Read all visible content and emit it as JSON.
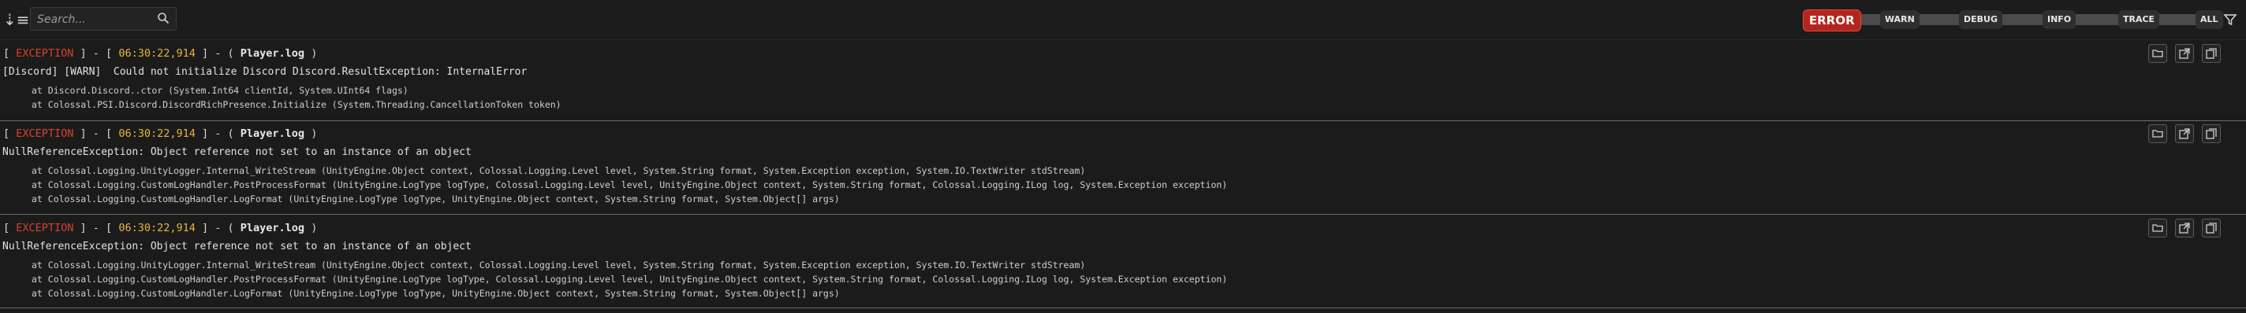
{
  "toolbar": {
    "search": {
      "placeholder": "Search..."
    },
    "levels": [
      {
        "label": "ERROR",
        "active": true
      },
      {
        "label": "WARN",
        "active": false
      },
      {
        "label": "DEBUG",
        "active": false
      },
      {
        "label": "INFO",
        "active": false
      },
      {
        "label": "TRACE",
        "active": false
      },
      {
        "label": "ALL",
        "active": false
      }
    ]
  },
  "entries": [
    {
      "level": "EXCEPTION",
      "time": "06:30:22,914",
      "file": "Player.log",
      "message": "[Discord] [WARN]  Could not initialize Discord Discord.ResultException: InternalError",
      "stack": [
        "at Discord.Discord..ctor (System.Int64 clientId, System.UInt64 flags)",
        "at Colossal.PSI.Discord.DiscordRichPresence.Initialize (System.Threading.CancellationToken token)"
      ]
    },
    {
      "level": "EXCEPTION",
      "time": "06:30:22,914",
      "file": "Player.log",
      "message": "NullReferenceException: Object reference not set to an instance of an object",
      "stack": [
        "at Colossal.Logging.UnityLogger.Internal_WriteStream (UnityEngine.Object context, Colossal.Logging.Level level, System.String format, System.Exception exception, System.IO.TextWriter stdStream)",
        "at Colossal.Logging.CustomLogHandler.PostProcessFormat (UnityEngine.LogType logType, Colossal.Logging.Level level, UnityEngine.Object context, System.String format, Colossal.Logging.ILog log, System.Exception exception)",
        "at Colossal.Logging.CustomLogHandler.LogFormat (UnityEngine.LogType logType, UnityEngine.Object context, System.String format, System.Object[] args)"
      ]
    },
    {
      "level": "EXCEPTION",
      "time": "06:30:22,914",
      "file": "Player.log",
      "message": "NullReferenceException: Object reference not set to an instance of an object",
      "stack": [
        "at Colossal.Logging.UnityLogger.Internal_WriteStream (UnityEngine.Object context, Colossal.Logging.Level level, System.String format, System.Exception exception, System.IO.TextWriter stdStream)",
        "at Colossal.Logging.CustomLogHandler.PostProcessFormat (UnityEngine.LogType logType, Colossal.Logging.Level level, UnityEngine.Object context, System.String format, Colossal.Logging.ILog log, System.Exception exception)",
        "at Colossal.Logging.CustomLogHandler.LogFormat (UnityEngine.LogType logType, UnityEngine.Object context, System.String format, System.Object[] args)"
      ]
    }
  ],
  "colors": {
    "accent": "#b5251f",
    "exception": "#d9412f",
    "time": "#e6b53f"
  }
}
